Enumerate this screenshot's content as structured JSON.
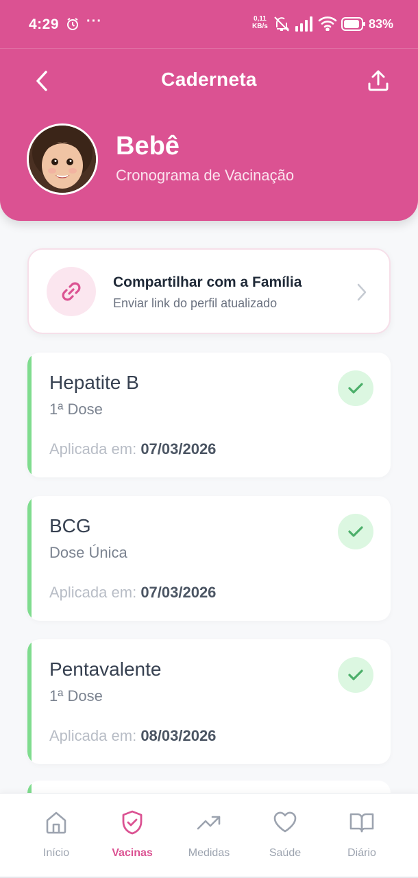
{
  "status_bar": {
    "time": "4:29",
    "dots": "···",
    "net_speed_value": "0,11",
    "net_speed_unit": "KB/s",
    "battery": "83%"
  },
  "header": {
    "title": "Caderneta",
    "profile_name": "Bebê",
    "profile_subtitle": "Cronograma de Vacinação"
  },
  "family_share": {
    "title": "Compartilhar com a Família",
    "subtitle": "Enviar link do perfil atualizado"
  },
  "vaccines": [
    {
      "name": "Hepatite B",
      "dose": "1ª Dose",
      "applied_label": "Aplicada em:",
      "applied_date": "07/03/2026",
      "status": "applied"
    },
    {
      "name": "BCG",
      "dose": "Dose Única",
      "applied_label": "Aplicada em:",
      "applied_date": "07/03/2026",
      "status": "applied"
    },
    {
      "name": "Pentavalente",
      "dose": "1ª Dose",
      "applied_label": "Aplicada em:",
      "applied_date": "08/03/2026",
      "status": "applied"
    }
  ],
  "bottom_nav": [
    {
      "label": "Início",
      "icon": "home-icon",
      "active": false
    },
    {
      "label": "Vacinas",
      "icon": "shield-check-icon",
      "active": true
    },
    {
      "label": "Medidas",
      "icon": "trending-up-icon",
      "active": false
    },
    {
      "label": "Saúde",
      "icon": "heart-icon",
      "active": false
    },
    {
      "label": "Diário",
      "icon": "book-icon",
      "active": false
    }
  ],
  "colors": {
    "primary": "#db5292",
    "success": "#7fdc8e",
    "success_bg": "#dcf7e1",
    "background": "#f7f8fa"
  }
}
